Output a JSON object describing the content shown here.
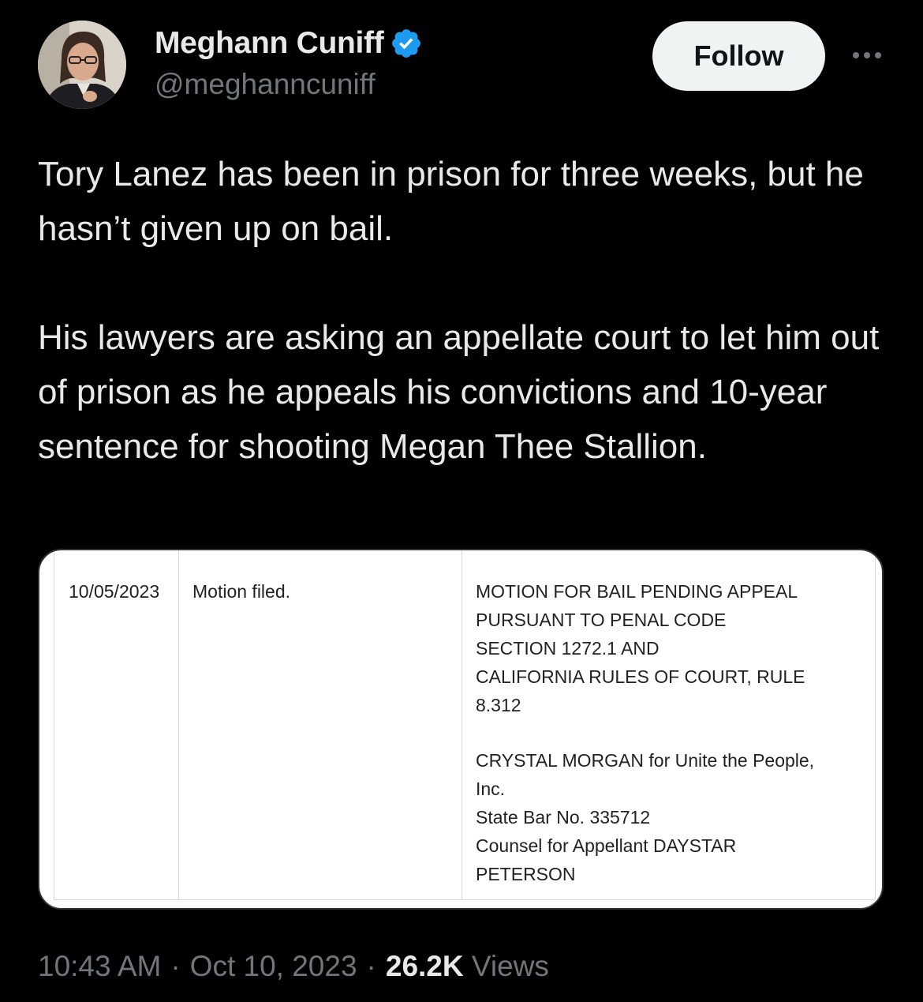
{
  "author": {
    "display_name": "Meghann Cuniff",
    "handle": "@meghanncuniff",
    "verified": true,
    "verified_color": "#1d9bf0"
  },
  "actions": {
    "follow_label": "Follow",
    "more_icon": "more-horizontal-icon"
  },
  "tweet": {
    "paragraph_1": "Tory Lanez has been in prison for three weeks, but he hasn’t given up on bail.",
    "paragraph_2": "His lawyers are asking an appellate court to let him out of prison as he appeals his convictions and 10-year sentence for shooting Megan Thee Stallion."
  },
  "media": {
    "date": "10/05/2023",
    "action": "Motion filed.",
    "description_lines": [
      "MOTION FOR BAIL PENDING APPEAL",
      "PURSUANT TO PENAL CODE",
      "SECTION 1272.1 AND",
      "CALIFORNIA RULES OF COURT, RULE",
      "8.312"
    ],
    "counsel_lines": [
      "CRYSTAL MORGAN for Unite the People,",
      "Inc.",
      "State Bar No. 335712",
      "Counsel for Appellant DAYSTAR",
      "PETERSON"
    ]
  },
  "meta": {
    "time": "10:43 AM",
    "separator": "·",
    "date": "Oct 10, 2023",
    "views_count": "26.2K",
    "views_label": "Views"
  },
  "colors": {
    "background": "#000000",
    "text_primary": "#e7e9ea",
    "text_secondary": "#71767b",
    "follow_bg": "#eff3f4"
  }
}
